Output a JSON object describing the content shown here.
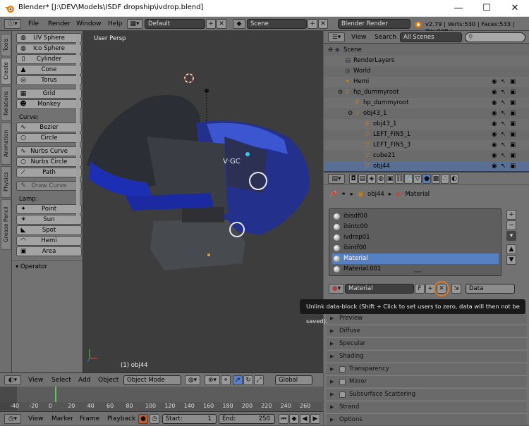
{
  "window": {
    "title": "Blender* [J:\\DEV\\Models\\ISDF dropship\\ivdrop.blend]",
    "minimize": "—",
    "maximize": "☐",
    "close": "✕"
  },
  "info_header": {
    "menus": [
      "File",
      "Render",
      "Window",
      "Help"
    ],
    "layout": "Default",
    "scene": "Scene",
    "engine": "Blender Render",
    "stats": "v2.79 | Verts:530 | Faces:533 | Tris:938 |"
  },
  "tool_tabs": [
    "Tools",
    "Create",
    "Relations",
    "Animation",
    "Physics",
    "Grease Pencil"
  ],
  "tool_shelf": {
    "mesh_items": [
      "UV Sphere",
      "Ico Sphere",
      "Cylinder",
      "Cone",
      "Torus"
    ],
    "misc_items": [
      "Grid",
      "Monkey"
    ],
    "curve_label": "Curve:",
    "curve_items": [
      "Bezier",
      "Circle"
    ],
    "nurbs_items": [
      "Nurbs Curve",
      "Nurbs Circle",
      "Path"
    ],
    "draw_curve": "Draw Curve",
    "lamp_label": "Lamp:",
    "lamp_items": [
      "Point",
      "Sun",
      "Spot",
      "Hemi",
      "Area"
    ],
    "operator_label": "Operator"
  },
  "viewport": {
    "view_label": "User Persp",
    "object_label": "(1) obj44"
  },
  "viewport_header": {
    "menus": [
      "View",
      "Select",
      "Add",
      "Object"
    ],
    "mode": "Object Mode",
    "orientation": "Global"
  },
  "timeline": {
    "ticks": [
      "-40",
      "-20",
      "0",
      "20",
      "40",
      "60",
      "80",
      "100",
      "120",
      "140",
      "160",
      "180",
      "200",
      "220",
      "240",
      "260"
    ],
    "menus": [
      "View",
      "Marker",
      "Frame",
      "Playback"
    ],
    "start_label": "Start:",
    "start_value": "1",
    "end_label": "End:",
    "end_value": "250"
  },
  "outliner_header": {
    "view": "View",
    "search": "Search",
    "filter": "All Scenes"
  },
  "outliner": {
    "rows": [
      {
        "label": "Scene",
        "indent": 0
      },
      {
        "label": "RenderLayers",
        "indent": 1
      },
      {
        "label": "World",
        "indent": 1
      },
      {
        "label": "Hemi",
        "indent": 1
      },
      {
        "label": "hp_dummyroot",
        "indent": 1
      },
      {
        "label": "hp_dummyroot",
        "indent": 2
      },
      {
        "label": "obj43_1",
        "indent": 2
      },
      {
        "label": "obj43_1",
        "indent": 3
      },
      {
        "label": "LEFT_FIN5_1",
        "indent": 3
      },
      {
        "label": "LEFT_FIN5_3",
        "indent": 3
      },
      {
        "label": "cube21",
        "indent": 3
      },
      {
        "label": "obj44",
        "indent": 3
      }
    ]
  },
  "properties": {
    "breadcrumb_object": "obj44",
    "breadcrumb_material": "Material",
    "material_slots": [
      "ibisdf00",
      "ibintc00",
      "ivdrop01",
      "ibintf00",
      "Material",
      "Material.001"
    ],
    "selected_slot": "Material",
    "datablock_name": "Material",
    "fake_user": "F",
    "data_link": "Data",
    "tooltip": "Unlink data-block (Shift + Click to set users to zero, data will then not be saved).",
    "panels": [
      "Preview",
      "Diffuse",
      "Specular",
      "Shading",
      "Transparency",
      "Mirror",
      "Subsurface Scattering",
      "Strand",
      "Options"
    ]
  },
  "colors": {
    "selected": "#5680c2",
    "highlight_ring": "#e07a2a"
  }
}
